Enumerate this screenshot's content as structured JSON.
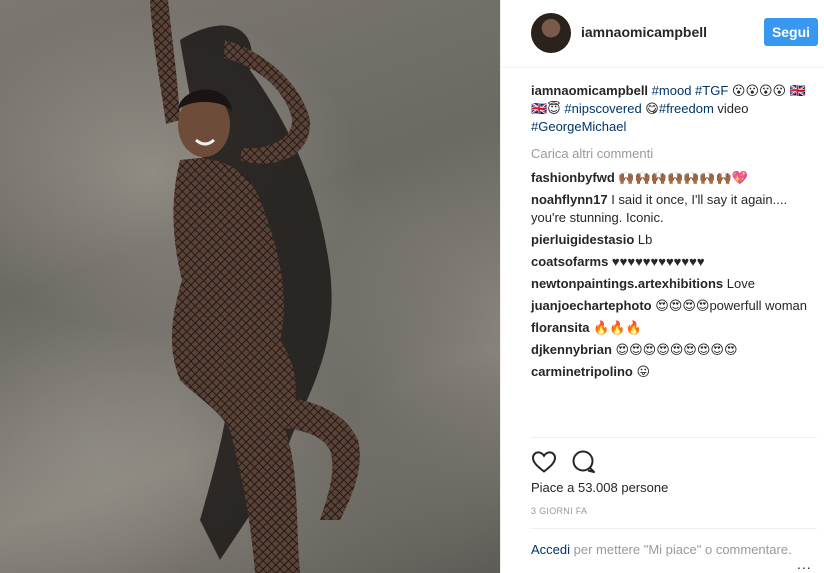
{
  "post": {
    "image_alt_icon": "fashion-photo"
  },
  "header": {
    "username": "iamnaomicampbell",
    "follow_label": "Segui"
  },
  "caption": {
    "username": "iamnaomicampbell",
    "t1": "#mood",
    "t2": "#TGF",
    "emoji1": " 😮😮😮😮",
    "emoji2": "🇬🇧🇬🇧😇 ",
    "t3": "#nipscovered",
    "emoji3": " 😋",
    "t4": "#freedom",
    "text": " video ",
    "t5": "#GeorgeMichael"
  },
  "load_more": "Carica altri commenti",
  "comments": [
    {
      "user": "fashionbyfwd",
      "text": " 🙌🏾🙌🏾🙌🏾🙌🏾🙌🏾🙌🏾🙌🏾💖"
    },
    {
      "user": "noahflynn17",
      "text": " I said it once, I'll say it again.... you're stunning. Iconic."
    },
    {
      "user": "pierluigidestasio",
      "text": " Lb"
    },
    {
      "user": "coatsofarms",
      "text": " ♥♥♥♥♥♥♥♥♥♥♥♥"
    },
    {
      "user": "newtonpaintings.artexhibitions",
      "text": " Love"
    },
    {
      "user": "juanjoechartephoto",
      "text": " 😍😍😍😍powerfull woman"
    },
    {
      "user": "floransita",
      "text": " 🔥🔥🔥"
    },
    {
      "user": "djkennybrian",
      "text": " 😍😍😍😍😍😍😍😍😍"
    },
    {
      "user": "carminetripolino",
      "text": " 😛"
    }
  ],
  "actions": {
    "like_icon": "heart-icon",
    "comment_icon": "comment-icon"
  },
  "likes_text": "Piace a 53.008 persone",
  "time_ago": "3 GIORNI FA",
  "footer": {
    "login_link": "Accedi",
    "rest": " per mettere \"Mi piace\" o commentare.",
    "more": "..."
  }
}
